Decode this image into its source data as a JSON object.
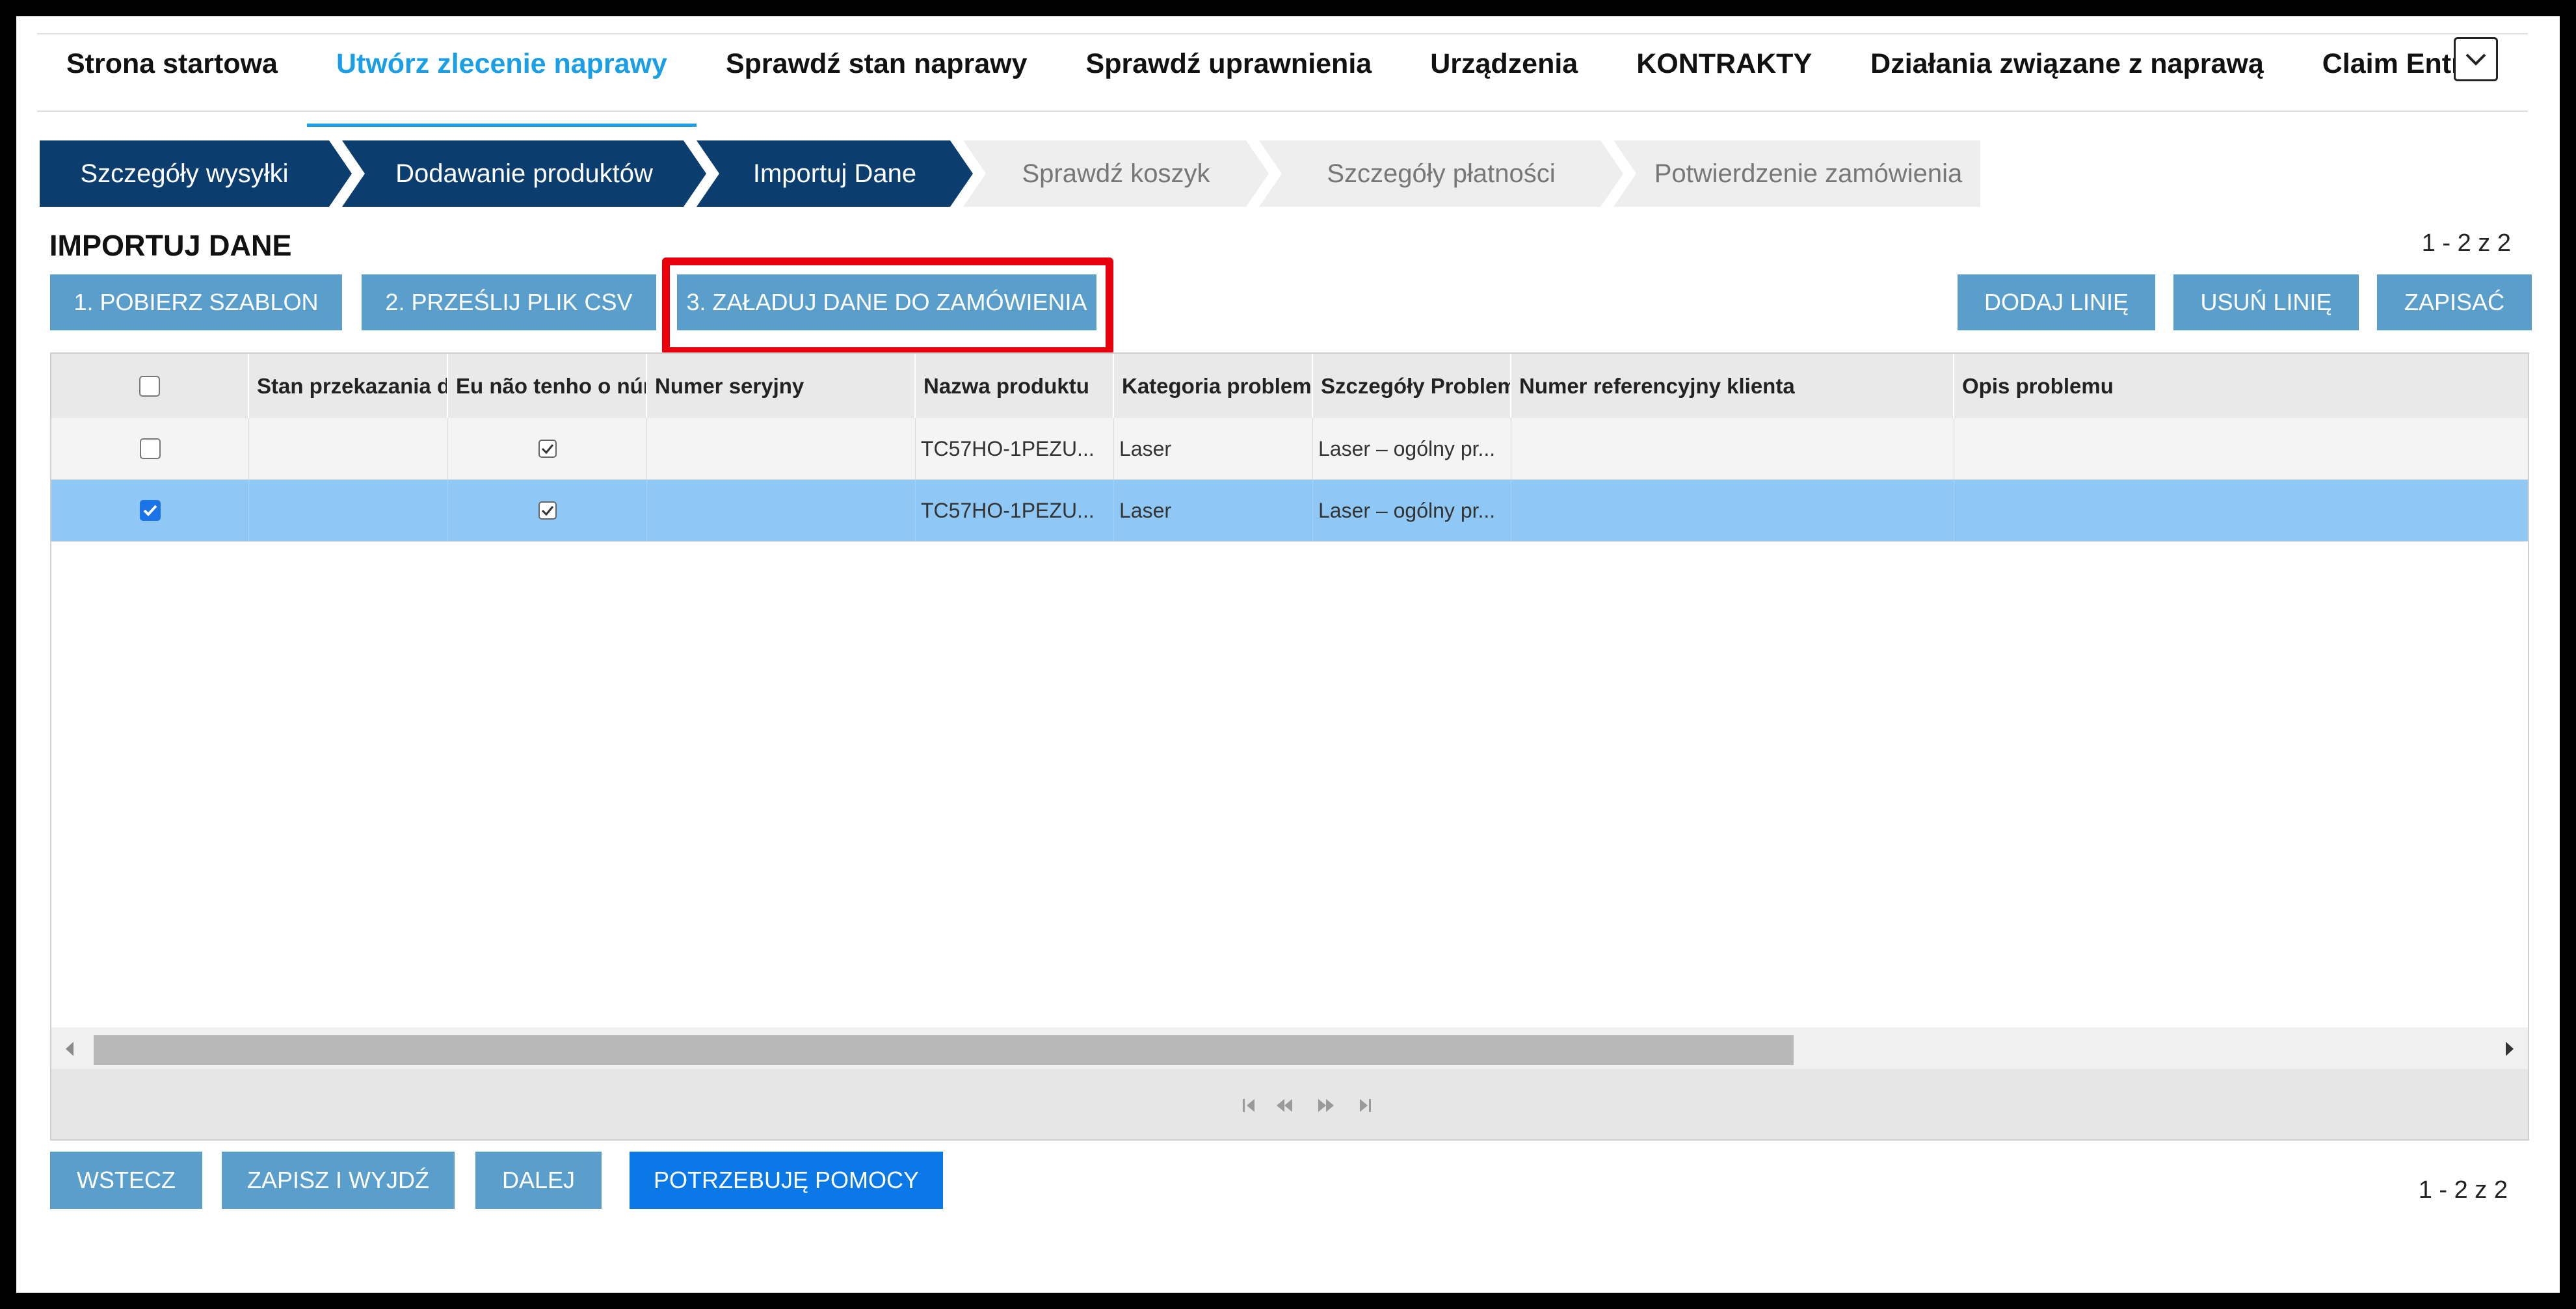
{
  "nav": {
    "items": [
      {
        "label": "Strona startowa",
        "active": false
      },
      {
        "label": "Utwórz zlecenie naprawy",
        "active": true
      },
      {
        "label": "Sprawdź stan naprawy",
        "active": false
      },
      {
        "label": "Sprawdź uprawnienia",
        "active": false
      },
      {
        "label": "Urządzenia",
        "active": false
      },
      {
        "label": "KONTRAKTY",
        "active": false
      },
      {
        "label": "Działania związane z naprawą",
        "active": false
      },
      {
        "label": "Claim Entry",
        "active": false
      }
    ],
    "more_icon": "chevron-down-icon"
  },
  "steps": [
    {
      "label": "Szczegóły wysyłki",
      "state": "done"
    },
    {
      "label": "Dodawanie produktów",
      "state": "done"
    },
    {
      "label": "Importuj Dane",
      "state": "current"
    },
    {
      "label": "Sprawdź koszyk",
      "state": "todo"
    },
    {
      "label": "Szczegóły płatności",
      "state": "todo"
    },
    {
      "label": "Potwierdzenie zamówienia",
      "state": "todo"
    }
  ],
  "page": {
    "title": "IMPORTUJ DANE",
    "pager_top": "1 - 2 z 2",
    "pager_bottom": "1 - 2 z 2"
  },
  "actions": {
    "download_template": "1. POBIERZ SZABLON",
    "upload_csv": "2. PRZEŚLIJ PLIK CSV",
    "load_data": "3. ZAŁADUJ DANE DO ZAMÓWIENIA",
    "add_line": "DODAJ LINIĘ",
    "remove_line": "USUŃ LINIĘ",
    "save": "ZAPISAĆ"
  },
  "grid": {
    "columns": [
      "",
      "Stan przekazania d",
      "Eu não tenho o núr",
      "Numer seryjny",
      "Nazwa produktu",
      "Kategoria problemu",
      "Szczegóły Problem",
      "Numer referencyjny klienta",
      "Opis problemu"
    ],
    "rows": [
      {
        "selected": false,
        "stan": "",
        "no_number": true,
        "serial": "",
        "product": "TC57HO-1PEZU...",
        "category": "Laser",
        "details": "Laser – ogólny pr...",
        "reference": "",
        "description": ""
      },
      {
        "selected": true,
        "stan": "",
        "no_number": true,
        "serial": "",
        "product": "TC57HO-1PEZU...",
        "category": "Laser",
        "details": "Laser – ogólny pr...",
        "reference": "",
        "description": ""
      }
    ],
    "colors": {
      "header_bg": "#e9e9e9",
      "selected_row": "#8fc8f4",
      "stripe_row": "#f4f4f4"
    }
  },
  "footer": {
    "back": "WSTECZ",
    "save_exit": "ZAPISZ I WYJDŹ",
    "next": "DALEJ",
    "help": "POTRZEBUJĘ POMOCY"
  },
  "colors": {
    "accent": "#1a9fe6",
    "step_done": "#0b3e6e",
    "button": "#5a9fcc",
    "button_primary": "#0a78e6",
    "highlight": "#e8000d"
  }
}
